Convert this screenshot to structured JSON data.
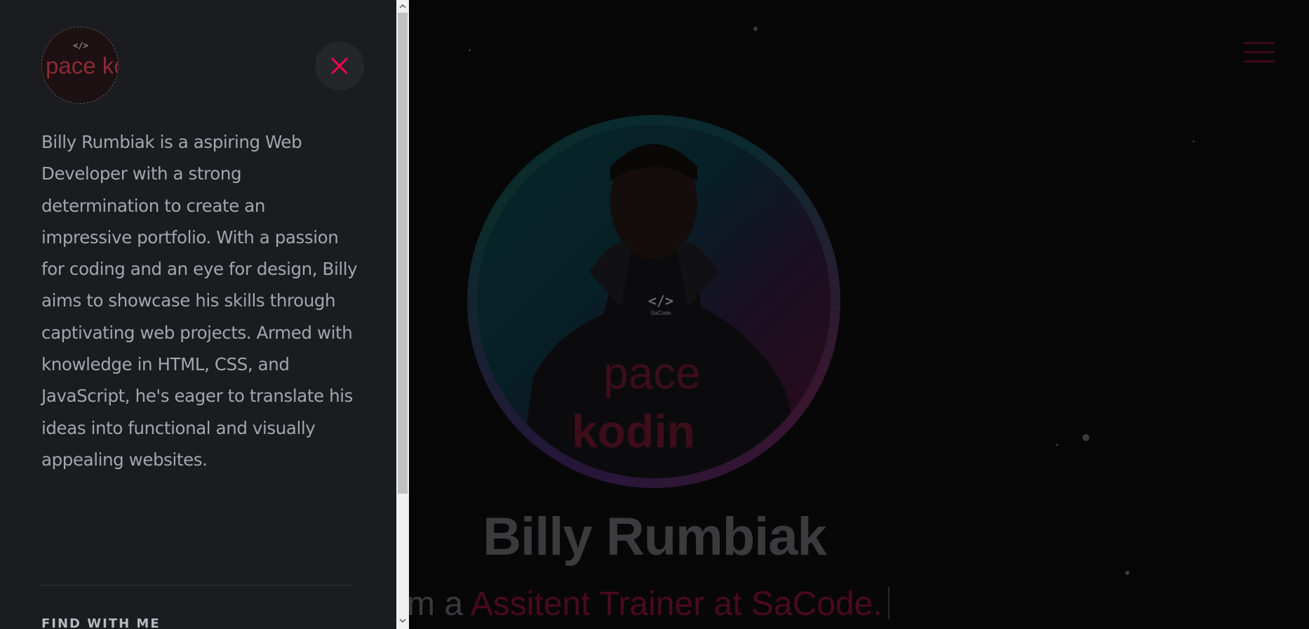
{
  "background_page": {
    "hero": {
      "name": "Billy Rumbiak",
      "role_prefix": "m a",
      "role_text": "Assitent Trainer at SaCode."
    }
  },
  "side_panel": {
    "bio": "Billy Rumbiak is a aspiring Web Developer with a strong determination to create an impressive portfolio. With a passion for coding and an eye for design, Billy aims to showcase his skills through captivating web projects. Armed with knowledge in HTML, CSS, and JavaScript, he's eager to translate his ideas into functional and visually appealing websites.",
    "find_heading": "FIND WITH ME",
    "avatar_text": "pace kodin"
  },
  "hero_photo": {
    "shirt_logo": "</>",
    "shirt_brand_small": "SaCode",
    "shirt_word1": "pace",
    "shirt_word2": "kodin"
  },
  "icons": {
    "close": "close-icon",
    "menu": "hamburger-menu-icon",
    "scroll_up": "chevron-up-icon",
    "scroll_down": "chevron-down-icon"
  },
  "colors": {
    "panel_bg": "#1b1c20",
    "page_bg": "#070708",
    "accent": "#ff014f",
    "bio_text": "#a2a6ae"
  }
}
